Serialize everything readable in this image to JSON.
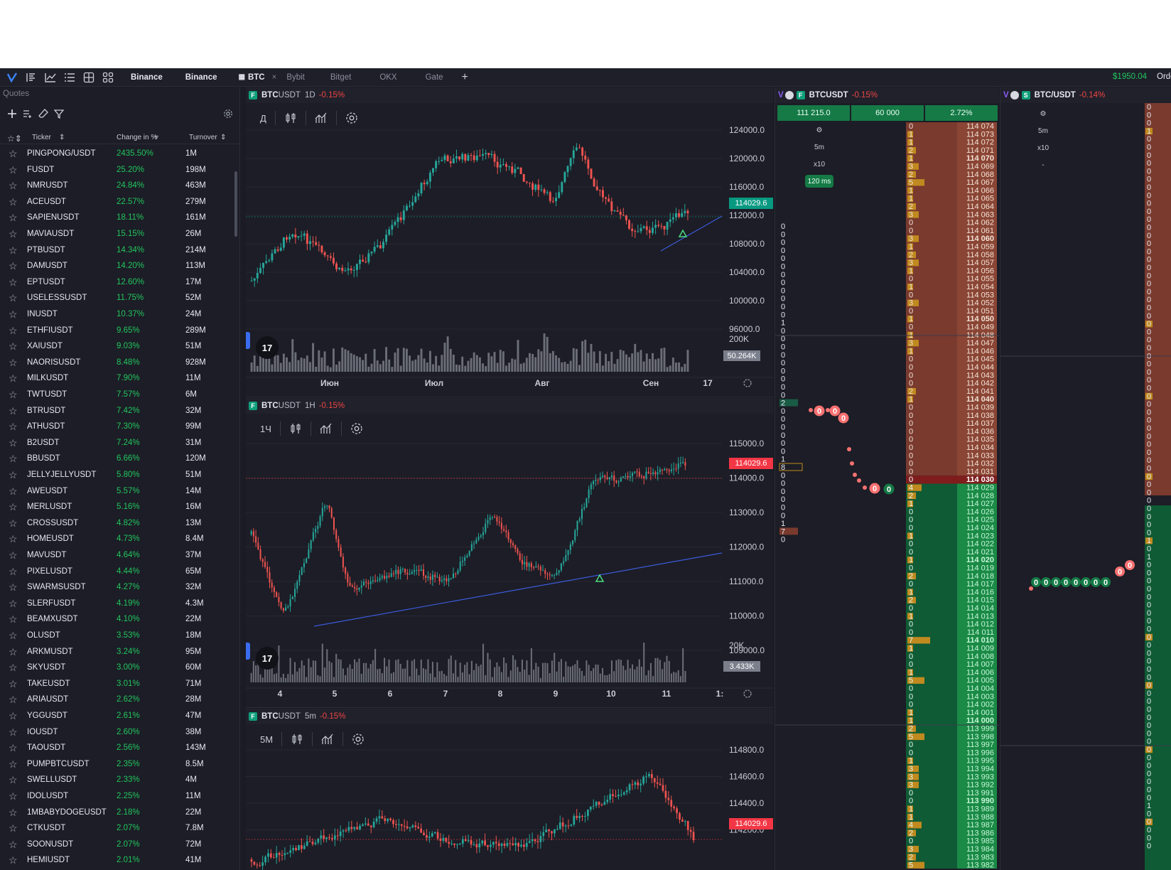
{
  "topbar": {
    "exchanges": [
      "Binance",
      "Binance"
    ],
    "tabs": [
      {
        "label": "BTC",
        "active": true
      },
      {
        "label": "Bybit",
        "active": false
      },
      {
        "label": "Bitget",
        "active": false
      },
      {
        "label": "OKX",
        "active": false
      },
      {
        "label": "Gate",
        "active": false
      }
    ],
    "balance": "$1950.04",
    "orders_label": "Orders"
  },
  "quotes": {
    "title": "Quotes",
    "columns": {
      "ticker": "Ticker",
      "change": "Change in %",
      "turnover": "Turnover"
    },
    "rows": [
      {
        "ticker": "PINGPONG/USDT",
        "change": "2435.50%",
        "turnover": "1M"
      },
      {
        "ticker": "FUSDT",
        "change": "25.20%",
        "turnover": "198M"
      },
      {
        "ticker": "NMRUSDT",
        "change": "24.84%",
        "turnover": "463M"
      },
      {
        "ticker": "ACEUSDT",
        "change": "22.57%",
        "turnover": "279M"
      },
      {
        "ticker": "SAPIENUSDT",
        "change": "18.11%",
        "turnover": "161M"
      },
      {
        "ticker": "MAVIAUSDT",
        "change": "15.15%",
        "turnover": "26M"
      },
      {
        "ticker": "PTBUSDT",
        "change": "14.34%",
        "turnover": "214M"
      },
      {
        "ticker": "DAMUSDT",
        "change": "14.20%",
        "turnover": "113M"
      },
      {
        "ticker": "EPTUSDT",
        "change": "12.60%",
        "turnover": "17M"
      },
      {
        "ticker": "USELESSUSDT",
        "change": "11.75%",
        "turnover": "52M"
      },
      {
        "ticker": "INUSDT",
        "change": "10.37%",
        "turnover": "24M"
      },
      {
        "ticker": "ETHFIUSDT",
        "change": "9.65%",
        "turnover": "289M"
      },
      {
        "ticker": "XAIUSDT",
        "change": "9.03%",
        "turnover": "51M"
      },
      {
        "ticker": "NAORISUSDT",
        "change": "8.48%",
        "turnover": "928M"
      },
      {
        "ticker": "MILKUSDT",
        "change": "7.90%",
        "turnover": "11M"
      },
      {
        "ticker": "TWTUSDT",
        "change": "7.57%",
        "turnover": "6M"
      },
      {
        "ticker": "BTRUSDT",
        "change": "7.42%",
        "turnover": "32M"
      },
      {
        "ticker": "ATHUSDT",
        "change": "7.30%",
        "turnover": "99M"
      },
      {
        "ticker": "B2USDT",
        "change": "7.24%",
        "turnover": "31M"
      },
      {
        "ticker": "BBUSDT",
        "change": "6.66%",
        "turnover": "120M"
      },
      {
        "ticker": "JELLYJELLYUSDT",
        "change": "5.80%",
        "turnover": "51M"
      },
      {
        "ticker": "AWEUSDT",
        "change": "5.57%",
        "turnover": "14M"
      },
      {
        "ticker": "MERLUSDT",
        "change": "5.16%",
        "turnover": "16M"
      },
      {
        "ticker": "CROSSUSDT",
        "change": "4.82%",
        "turnover": "13M"
      },
      {
        "ticker": "HOMEUSDT",
        "change": "4.73%",
        "turnover": "8.4M"
      },
      {
        "ticker": "MAVUSDT",
        "change": "4.64%",
        "turnover": "37M"
      },
      {
        "ticker": "PIXELUSDT",
        "change": "4.44%",
        "turnover": "65M"
      },
      {
        "ticker": "SWARMSUSDT",
        "change": "4.27%",
        "turnover": "32M"
      },
      {
        "ticker": "SLERFUSDT",
        "change": "4.19%",
        "turnover": "4.3M"
      },
      {
        "ticker": "BEAMXUSDT",
        "change": "4.10%",
        "turnover": "22M"
      },
      {
        "ticker": "OLUSDT",
        "change": "3.53%",
        "turnover": "18M"
      },
      {
        "ticker": "ARKMUSDT",
        "change": "3.24%",
        "turnover": "95M"
      },
      {
        "ticker": "SKYUSDT",
        "change": "3.00%",
        "turnover": "60M"
      },
      {
        "ticker": "TAKEUSDT",
        "change": "3.01%",
        "turnover": "71M"
      },
      {
        "ticker": "ARIAUSDT",
        "change": "2.62%",
        "turnover": "28M"
      },
      {
        "ticker": "YGGUSDT",
        "change": "2.61%",
        "turnover": "47M"
      },
      {
        "ticker": "IOUSDT",
        "change": "2.60%",
        "turnover": "38M"
      },
      {
        "ticker": "TAOUSDT",
        "change": "2.56%",
        "turnover": "143M"
      },
      {
        "ticker": "PUMPBTCUSDT",
        "change": "2.35%",
        "turnover": "8.5M"
      },
      {
        "ticker": "SWELLUSDT",
        "change": "2.33%",
        "turnover": "4M"
      },
      {
        "ticker": "IDOLUSDT",
        "change": "2.25%",
        "turnover": "11M"
      },
      {
        "ticker": "1MBABYDOGEUSDT",
        "change": "2.18%",
        "turnover": "22M"
      },
      {
        "ticker": "CTKUSDT",
        "change": "2.07%",
        "turnover": "7.8M"
      },
      {
        "ticker": "SOONUSDT",
        "change": "2.07%",
        "turnover": "72M"
      },
      {
        "ticker": "HEMIUSDT",
        "change": "2.01%",
        "turnover": "41M"
      }
    ]
  },
  "charts": [
    {
      "symbol_bold": "BTC",
      "symbol_rest": "USDT",
      "timeframe": "1D",
      "change": "-0.15%",
      "interval_button": "Д",
      "y_ticks": [
        "124000.0",
        "120000.0",
        "116000.0",
        "112000.0",
        "108000.0",
        "104000.0",
        "100000.0",
        "96000.0"
      ],
      "x_ticks": [
        "Июн",
        "Июл",
        "Авг",
        "Сен",
        "17"
      ],
      "price_tag": "114029.6",
      "volume_axis": "200K",
      "volume_tag": "50.264K",
      "tv_logo": "17"
    },
    {
      "symbol_bold": "BTC",
      "symbol_rest": "USDT",
      "timeframe": "1H",
      "change": "-0.15%",
      "interval_button": "1Ч",
      "y_ticks": [
        "115000.0",
        "114000.0",
        "113000.0",
        "112000.0",
        "111000.0",
        "110000.0",
        "109000.0"
      ],
      "x_ticks": [
        "4",
        "5",
        "6",
        "7",
        "8",
        "9",
        "10",
        "11",
        "1:"
      ],
      "price_tag": "114029.6",
      "volume_axis": "20K",
      "volume_tag": "3.433K",
      "tv_logo": "17"
    },
    {
      "symbol_bold": "BTC",
      "symbol_rest": "USDT",
      "timeframe": "5m",
      "change": "-0.15%",
      "interval_button": "5М",
      "y_ticks": [
        "114800.0",
        "114600.0",
        "114400.0",
        "114200.0"
      ],
      "x_ticks": [],
      "price_tag": "114029.6"
    }
  ],
  "orderbook": {
    "exchange_badge": "F",
    "symbol": "BTCUSDT",
    "change": "-0.15%",
    "stats": [
      "111 215.0",
      "60 000",
      "2.72%"
    ],
    "controls": {
      "tf": "5m",
      "mult": "x10",
      "latency": "120 ms"
    },
    "last_price": "114 030",
    "asks": [
      "114 074",
      "114 073",
      "114 072",
      "114 071",
      "114 070",
      "114 069",
      "114 068",
      "114 067",
      "114 066",
      "114 065",
      "114 064",
      "114 063",
      "114 062",
      "114 061",
      "114 060",
      "114 059",
      "114 058",
      "114 057",
      "114 056",
      "114 055",
      "114 054",
      "114 053",
      "114 052",
      "114 051",
      "114 050",
      "114 049",
      "114 048",
      "114 047",
      "114 046",
      "114 045",
      "114 044",
      "114 043",
      "114 042",
      "114 041",
      "114 040",
      "114 039",
      "114 038",
      "114 037",
      "114 036",
      "114 035",
      "114 034",
      "114 033",
      "114 032",
      "114 031"
    ],
    "bids": [
      "114 029",
      "114 028",
      "114 027",
      "114 026",
      "114 025",
      "114 024",
      "114 023",
      "114 022",
      "114 021",
      "114 020",
      "114 019",
      "114 018",
      "114 017",
      "114 016",
      "114 015",
      "114 014",
      "114 013",
      "114 012",
      "114 011",
      "114 010",
      "114 009",
      "114 008",
      "114 007",
      "114 006",
      "114 005",
      "114 004",
      "114 003",
      "114 002",
      "114 001",
      "114 000",
      "113 999",
      "113 998",
      "113 997",
      "113 996",
      "113 995",
      "113 994",
      "113 993",
      "113 992",
      "113 991",
      "113 990",
      "113 989",
      "113 988",
      "113 987",
      "113 986",
      "113 985",
      "113 984",
      "113 983",
      "113 982"
    ],
    "ask_sizes": [
      0,
      1,
      1,
      2,
      1,
      3,
      2,
      5,
      1,
      1,
      2,
      3,
      0,
      0,
      3,
      1,
      2,
      3,
      1,
      0,
      1,
      0,
      3,
      0,
      1,
      0,
      1,
      3,
      1,
      0,
      0,
      0,
      0,
      2,
      1,
      0,
      0,
      0,
      0,
      0,
      0,
      0,
      0,
      0
    ],
    "bid_sizes": [
      4,
      2,
      1,
      0,
      0,
      0,
      1,
      0,
      0,
      1,
      0,
      2,
      0,
      1,
      2,
      0,
      1,
      0,
      0,
      7,
      1,
      0,
      0,
      1,
      5,
      0,
      0,
      0,
      1,
      1,
      2,
      5,
      0,
      0,
      1,
      3,
      3,
      3,
      0,
      0,
      1,
      1,
      4,
      2,
      0,
      3,
      2,
      5
    ],
    "left_col": [
      "0",
      "0",
      "0",
      "0",
      "0",
      "0",
      "0",
      "0",
      "0",
      "0",
      "0",
      "0",
      "1",
      "0",
      "0",
      "0",
      "0",
      "0",
      "0",
      "0",
      "0",
      "0",
      "2",
      "0",
      "0",
      "0",
      "0",
      "0",
      "0",
      "1",
      "8",
      "0",
      "0",
      "0",
      "0",
      "0",
      "0",
      "1",
      "7",
      "0"
    ],
    "bubbles": [
      "0",
      "0",
      "0",
      "0",
      "0",
      "0",
      "0",
      "0"
    ]
  },
  "orderbook2": {
    "exchange_badge": "S",
    "symbol": "BTC/USDT",
    "change": "-0.14%",
    "controls": {
      "tf": "5m",
      "mult": "x10",
      "dash": "-"
    },
    "bubbles": [
      "0",
      "0",
      "0",
      "0",
      "0",
      "0",
      "0",
      "0",
      "0",
      "0"
    ]
  }
}
